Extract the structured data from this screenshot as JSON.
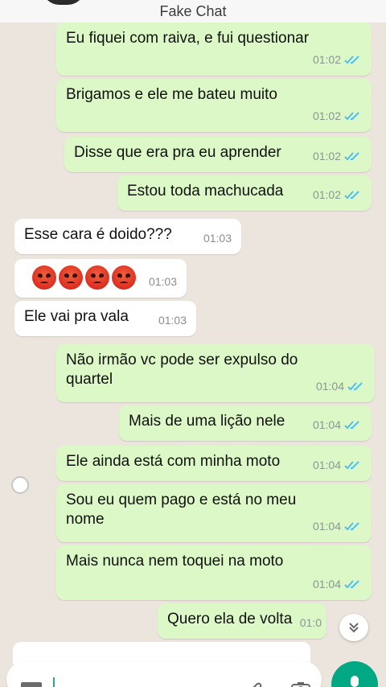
{
  "header": {
    "title": "Fake Chat"
  },
  "messages": [
    {
      "text": "Eu fiquei com raiva, e fui questionar",
      "time": "01:02"
    },
    {
      "text": "Brigamos e ele me bateu muito",
      "time": "01:02"
    },
    {
      "text": "Disse que era pra eu aprender",
      "time": "01:02"
    },
    {
      "text": "Estou toda machucada",
      "time": "01:02"
    },
    {
      "text": "Esse cara é doido???",
      "time": "01:03"
    },
    {
      "text": "",
      "time": "01:03"
    },
    {
      "text": "Ele vai pra vala",
      "time": "01:03"
    },
    {
      "text": "Não irmão vc pode ser expulso do quartel",
      "time": "01:04"
    },
    {
      "text": "Mais de uma lição nele",
      "time": "01:04"
    },
    {
      "text": "Ele ainda está com minha moto",
      "time": "01:04"
    },
    {
      "text": "Sou eu quem pago e está no meu nome",
      "time": "01:04"
    },
    {
      "text": "Mais nunca nem toquei na moto",
      "time": "01:04"
    },
    {
      "text": "Quero ela de volta",
      "time": "01:0"
    }
  ],
  "icons": {
    "read": "double-check-icon",
    "emoji": "angry-face-icon",
    "scroll": "chevron-double-down-icon",
    "keyboard": "keyboard-icon",
    "attach": "paperclip-icon",
    "camera": "camera-icon",
    "mic": "mic-icon"
  },
  "colors": {
    "outgoing": "#dcf8c6",
    "incoming": "#ffffff",
    "background": "#ece5dd",
    "read_ticks": "#53bdeb",
    "accent": "#00a884"
  }
}
